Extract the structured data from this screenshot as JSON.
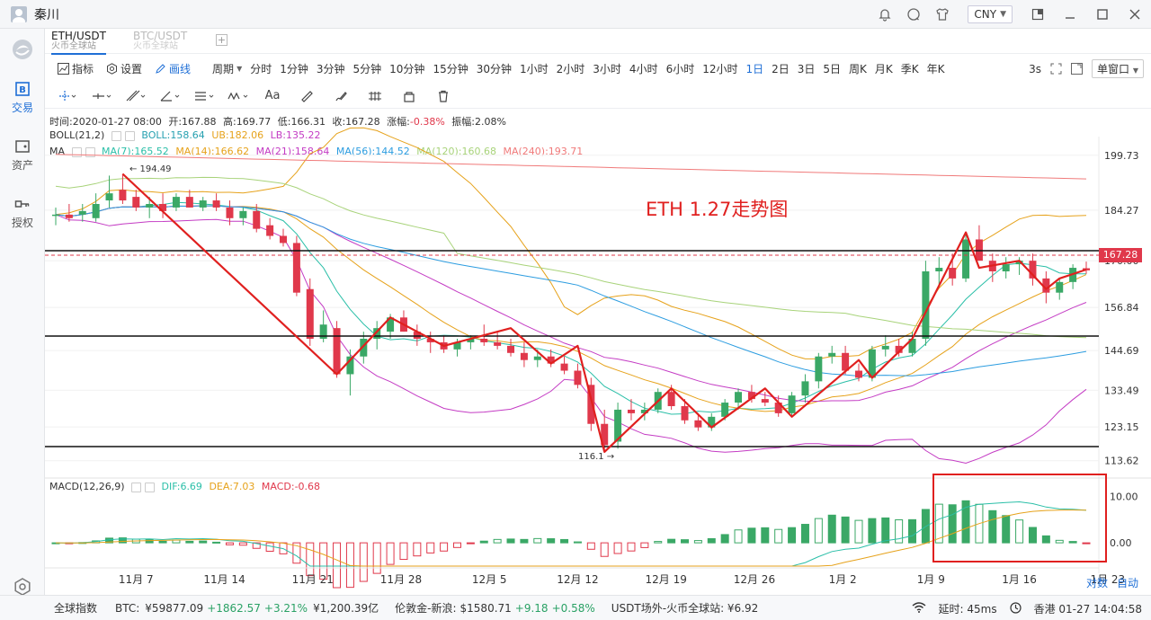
{
  "user": {
    "name": "秦川"
  },
  "currency": "CNY",
  "sidebar": {
    "items": [
      {
        "label": "交易",
        "icon": "trade-icon"
      },
      {
        "label": "资产",
        "icon": "asset-icon"
      },
      {
        "label": "授权",
        "icon": "key-icon"
      }
    ]
  },
  "tabs": [
    {
      "label": "ETH/USDT",
      "sub": "火币全球站"
    },
    {
      "label": "BTC/USDT",
      "sub": "火币全球站"
    }
  ],
  "toolbar": {
    "indicator": "指标",
    "settings": "设置",
    "draw": "画线",
    "period_label": "周期",
    "periods": [
      "分时",
      "1分钟",
      "3分钟",
      "5分钟",
      "10分钟",
      "15分钟",
      "30分钟",
      "1小时",
      "2小时",
      "3小时",
      "4小时",
      "6小时",
      "12小时",
      "1日",
      "2日",
      "3日",
      "5日",
      "周K",
      "月K",
      "季K",
      "年K"
    ],
    "active_period": "1日",
    "refresh": "3s",
    "window": "单窗口"
  },
  "candle_info": {
    "time": "时间:2020-01-27 08:00",
    "open": "开:167.88",
    "high": "高:169.77",
    "low": "低:166.31",
    "close": "收:167.28",
    "change_label": "涨幅:",
    "change": "-0.38%",
    "amp": "振幅:2.08%"
  },
  "boll": {
    "label": "BOLL(21,2)",
    "mid": "BOLL:158.64",
    "ub": "UB:182.06",
    "lb": "LB:135.22"
  },
  "ma": {
    "label": "MA",
    "values": [
      "MA(7):165.52",
      "MA(14):166.62",
      "MA(21):158.64",
      "MA(56):144.52",
      "MA(120):160.68",
      "MA(240):193.71"
    ]
  },
  "annotation": "ETH 1.27走势图",
  "high_label": "← 194.49",
  "low_label": "116.1 →",
  "price_axis": [
    "199.73",
    "184.27",
    "170.00",
    "156.84",
    "144.69",
    "133.49",
    "123.15",
    "113.62"
  ],
  "last_price": "167.28",
  "macd": {
    "label": "MACD(12,26,9)",
    "dif": "DIF:6.69",
    "dea": "DEA:7.03",
    "macd": "MACD:-0.68",
    "axis": [
      "10.00",
      "0.00"
    ]
  },
  "x_axis": [
    "11月 7",
    "11月 14",
    "11月 21",
    "11月 28",
    "12月 5",
    "12月 12",
    "12月 19",
    "12月 26",
    "1月 2",
    "1月 9",
    "1月 16",
    "1月 23"
  ],
  "axis_buttons": {
    "log": "对数",
    "auto": "自动"
  },
  "bottom": {
    "index": "全球指数",
    "btc_label": "BTC:",
    "btc_price": "¥59877.09",
    "btc_change": "+1862.57",
    "btc_pct": "+3.21%",
    "btc_vol": "¥1,200.39亿",
    "london_label": "伦敦金-新浪:",
    "london_price": "$1580.71",
    "london_change": "+9.18",
    "london_pct": "+0.58%",
    "usdt": "USDT场外-火币全球站: ¥6.92",
    "latency": "延时:",
    "latency_val": "45ms",
    "clock": "香港 01-27 14:04:58"
  },
  "chart_data": {
    "type": "candlestick",
    "title": "ETH 1.27走势图",
    "ylim": [
      110,
      205
    ],
    "y_ticks": [
      199.73,
      184.27,
      170.0,
      156.84,
      144.69,
      133.49,
      123.15,
      113.62
    ],
    "x_ticks": [
      "11月 7",
      "11月 14",
      "11月 21",
      "11月 28",
      "12月 5",
      "12月 12",
      "12月 19",
      "12月 26",
      "1月 2",
      "1月 9",
      "1月 16",
      "1月 23"
    ],
    "candles": [
      {
        "o": 183,
        "h": 185,
        "l": 180,
        "c": 183
      },
      {
        "o": 183,
        "h": 186,
        "l": 181,
        "c": 182
      },
      {
        "o": 183,
        "h": 186,
        "l": 181,
        "c": 184
      },
      {
        "o": 182,
        "h": 189,
        "l": 181,
        "c": 186
      },
      {
        "o": 187,
        "h": 194,
        "l": 185,
        "c": 189
      },
      {
        "o": 190,
        "h": 194.49,
        "l": 186,
        "c": 187
      },
      {
        "o": 188,
        "h": 190,
        "l": 184,
        "c": 185
      },
      {
        "o": 185,
        "h": 188,
        "l": 182,
        "c": 186
      },
      {
        "o": 186,
        "h": 189,
        "l": 182,
        "c": 184
      },
      {
        "o": 185,
        "h": 189,
        "l": 184,
        "c": 188
      },
      {
        "o": 188,
        "h": 190,
        "l": 185,
        "c": 185
      },
      {
        "o": 185,
        "h": 188,
        "l": 184,
        "c": 187
      },
      {
        "o": 187,
        "h": 189,
        "l": 184,
        "c": 185
      },
      {
        "o": 185,
        "h": 187,
        "l": 180,
        "c": 182
      },
      {
        "o": 182,
        "h": 185,
        "l": 180,
        "c": 184
      },
      {
        "o": 184,
        "h": 186,
        "l": 178,
        "c": 179
      },
      {
        "o": 180,
        "h": 182,
        "l": 176,
        "c": 177
      },
      {
        "o": 177,
        "h": 179,
        "l": 174,
        "c": 175
      },
      {
        "o": 175,
        "h": 177,
        "l": 160,
        "c": 161
      },
      {
        "o": 162,
        "h": 165,
        "l": 146,
        "c": 148
      },
      {
        "o": 148,
        "h": 156,
        "l": 147,
        "c": 152
      },
      {
        "o": 151,
        "h": 153,
        "l": 137,
        "c": 138
      },
      {
        "o": 138,
        "h": 145,
        "l": 132,
        "c": 143
      },
      {
        "o": 143,
        "h": 150,
        "l": 141,
        "c": 148
      },
      {
        "o": 148,
        "h": 153,
        "l": 145,
        "c": 151
      },
      {
        "o": 150,
        "h": 155,
        "l": 148,
        "c": 154
      },
      {
        "o": 154,
        "h": 156,
        "l": 150,
        "c": 150
      },
      {
        "o": 150,
        "h": 152,
        "l": 146,
        "c": 148
      },
      {
        "o": 148,
        "h": 150,
        "l": 144,
        "c": 147
      },
      {
        "o": 147,
        "h": 149,
        "l": 144,
        "c": 145
      },
      {
        "o": 145,
        "h": 148,
        "l": 143,
        "c": 147
      },
      {
        "o": 147,
        "h": 149,
        "l": 145,
        "c": 148
      },
      {
        "o": 148,
        "h": 152,
        "l": 146,
        "c": 147
      },
      {
        "o": 147,
        "h": 150,
        "l": 145,
        "c": 146
      },
      {
        "o": 146,
        "h": 148,
        "l": 143,
        "c": 144
      },
      {
        "o": 144,
        "h": 147,
        "l": 140,
        "c": 142
      },
      {
        "o": 142,
        "h": 145,
        "l": 140,
        "c": 143
      },
      {
        "o": 143,
        "h": 145,
        "l": 140,
        "c": 141
      },
      {
        "o": 141,
        "h": 143,
        "l": 138,
        "c": 139
      },
      {
        "o": 139,
        "h": 141,
        "l": 134,
        "c": 135
      },
      {
        "o": 135,
        "h": 137,
        "l": 122,
        "c": 124
      },
      {
        "o": 124,
        "h": 128,
        "l": 116.1,
        "c": 118
      },
      {
        "o": 119,
        "h": 130,
        "l": 117,
        "c": 128
      },
      {
        "o": 128,
        "h": 131,
        "l": 125,
        "c": 127
      },
      {
        "o": 127,
        "h": 130,
        "l": 125,
        "c": 128
      },
      {
        "o": 128,
        "h": 134,
        "l": 127,
        "c": 133
      },
      {
        "o": 133,
        "h": 135,
        "l": 128,
        "c": 129
      },
      {
        "o": 129,
        "h": 131,
        "l": 124,
        "c": 125
      },
      {
        "o": 125,
        "h": 127,
        "l": 122,
        "c": 123
      },
      {
        "o": 123,
        "h": 127,
        "l": 122,
        "c": 126
      },
      {
        "o": 126,
        "h": 131,
        "l": 125,
        "c": 130
      },
      {
        "o": 130,
        "h": 134,
        "l": 128,
        "c": 133
      },
      {
        "o": 133,
        "h": 135,
        "l": 130,
        "c": 131
      },
      {
        "o": 131,
        "h": 133,
        "l": 129,
        "c": 130
      },
      {
        "o": 130,
        "h": 132,
        "l": 126,
        "c": 127
      },
      {
        "o": 127,
        "h": 133,
        "l": 126,
        "c": 132
      },
      {
        "o": 132,
        "h": 138,
        "l": 130,
        "c": 136
      },
      {
        "o": 136,
        "h": 144,
        "l": 134,
        "c": 143
      },
      {
        "o": 143,
        "h": 146,
        "l": 141,
        "c": 144
      },
      {
        "o": 144,
        "h": 146,
        "l": 138,
        "c": 139
      },
      {
        "o": 139,
        "h": 141,
        "l": 136,
        "c": 137
      },
      {
        "o": 137,
        "h": 146,
        "l": 136,
        "c": 145
      },
      {
        "o": 145,
        "h": 149,
        "l": 143,
        "c": 146
      },
      {
        "o": 146,
        "h": 148,
        "l": 143,
        "c": 144
      },
      {
        "o": 144,
        "h": 150,
        "l": 143,
        "c": 148
      },
      {
        "o": 148,
        "h": 170,
        "l": 146,
        "c": 167
      },
      {
        "o": 167,
        "h": 171,
        "l": 163,
        "c": 168
      },
      {
        "o": 168,
        "h": 172,
        "l": 163,
        "c": 165
      },
      {
        "o": 165,
        "h": 178,
        "l": 164,
        "c": 176
      },
      {
        "o": 176,
        "h": 180,
        "l": 170,
        "c": 170
      },
      {
        "o": 170,
        "h": 172,
        "l": 164,
        "c": 167
      },
      {
        "o": 167,
        "h": 171,
        "l": 165,
        "c": 169
      },
      {
        "o": 169,
        "h": 171,
        "l": 166,
        "c": 170
      },
      {
        "o": 170,
        "h": 172,
        "l": 163,
        "c": 165
      },
      {
        "o": 165,
        "h": 167,
        "l": 158,
        "c": 161
      },
      {
        "o": 161,
        "h": 165,
        "l": 159,
        "c": 164
      },
      {
        "o": 164,
        "h": 169,
        "l": 162,
        "c": 168
      },
      {
        "o": 167.88,
        "h": 169.77,
        "l": 166.31,
        "c": 167.28
      }
    ],
    "macd_range": [
      -5,
      12
    ]
  }
}
